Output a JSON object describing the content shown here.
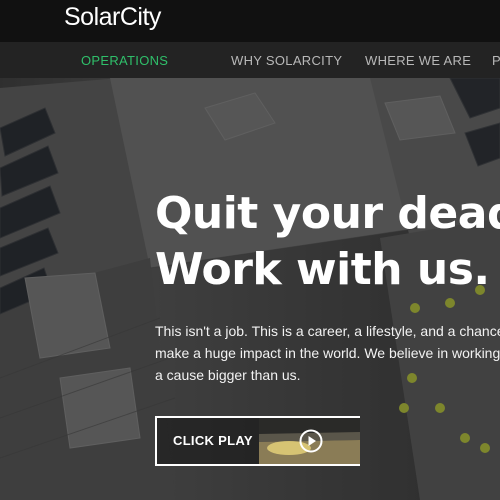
{
  "brand": {
    "logo": "SolarCity"
  },
  "nav": {
    "items": [
      {
        "label": "OPERATIONS",
        "active": true
      },
      {
        "label": "WHY SOLARCITY",
        "active": false
      },
      {
        "label": "WHERE WE ARE",
        "active": false
      }
    ]
  },
  "hero": {
    "headline_line1": "Quit your deadend",
    "headline_line2": "Work with us.",
    "intro_line1": "This isn't a job. This is a career, a lifestyle, and a chance to",
    "intro_line2": "make a huge impact in the world. We believe in working for",
    "intro_line3": "a cause bigger than us.",
    "video_button_label": "CLICK PLAY"
  },
  "colors": {
    "accent": "#2fbf6a",
    "topbar": "#111111",
    "navbar": "#232323"
  },
  "icons": [
    "play-icon"
  ]
}
